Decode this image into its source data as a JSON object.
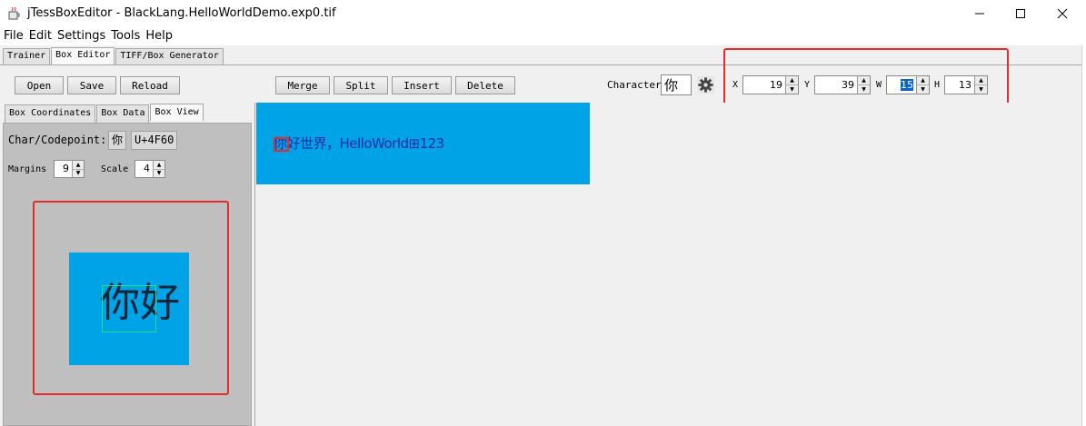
{
  "window": {
    "title": "jTessBoxEditor - BlackLang.HelloWorldDemo.exp0.tif",
    "controls": [
      "—",
      "☐",
      "✕"
    ]
  },
  "menu": [
    "File",
    "Edit",
    "Settings",
    "Tools",
    "Help"
  ],
  "main_tabs": [
    "Trainer",
    "Box Editor",
    "TIFF/Box Generator"
  ],
  "toolbar": {
    "open": "Open",
    "save": "Save",
    "reload": "Reload",
    "merge": "Merge",
    "split": "Split",
    "insert": "Insert",
    "delete": "Delete",
    "character_label": "Character",
    "character_value": "你",
    "x_label": "X",
    "x_value": "19",
    "y_label": "Y",
    "y_value": "39",
    "w_label": "W",
    "w_value": "15",
    "h_label": "H",
    "h_value": "13"
  },
  "left_tabs": [
    "Box Coordinates",
    "Box Data",
    "Box View"
  ],
  "box_view": {
    "codepoint_label": "Char/Codepoint:",
    "char": "你",
    "codepoint": "U+4F60",
    "margins_label": "Margins",
    "margins_value": "9",
    "scale_label": "Scale",
    "scale_value": "4",
    "zoom_text": "你好"
  },
  "image": {
    "text": "你好世界，HelloWorld⊞123"
  },
  "colors": {
    "image_bg": "#00a3e6",
    "highlight": "#e52b2b",
    "selection": "#0a64d0"
  }
}
